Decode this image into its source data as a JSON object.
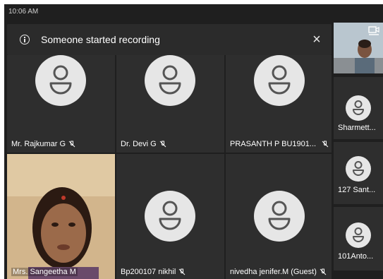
{
  "status": {
    "time": "10:06 AM"
  },
  "banner": {
    "text": "Someone started recording",
    "close": "×"
  },
  "grid": [
    {
      "name": "Mr. Rajkumar G"
    },
    {
      "name": "Dr. Devi G"
    },
    {
      "name": "PRASANTH P  BU1901..."
    },
    {
      "name": "Mrs. Sangeetha M"
    },
    {
      "name": "Bp200107 nikhil"
    },
    {
      "name": "nivedha jenifer.M (Guest)"
    }
  ],
  "sidebar": [
    {
      "name": "Sharmett..."
    },
    {
      "name": "127 Sant..."
    },
    {
      "name": "101Anto..."
    }
  ],
  "colors": {
    "background": "#1f1f1f",
    "tile": "#2e2e2e",
    "avatar": "#e6e6e6"
  },
  "icons": [
    "info-icon",
    "close-icon",
    "mic-off-icon",
    "person-icon",
    "camera-share-icon"
  ]
}
